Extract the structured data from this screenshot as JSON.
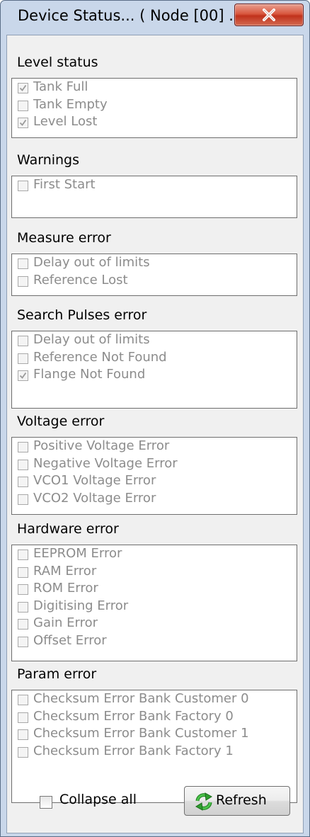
{
  "window": {
    "title": "Device Status... ( Node [00] ..."
  },
  "sections": [
    {
      "title": "Level status",
      "items": [
        {
          "label": "Tank Full",
          "checked": true
        },
        {
          "label": "Tank Empty",
          "checked": false
        },
        {
          "label": "Level Lost",
          "checked": true
        }
      ]
    },
    {
      "title": "Warnings",
      "items": [
        {
          "label": "First Start",
          "checked": false
        }
      ]
    },
    {
      "title": "Measure error",
      "items": [
        {
          "label": "Delay out of limits",
          "checked": false
        },
        {
          "label": "Reference Lost",
          "checked": false
        }
      ]
    },
    {
      "title": "Search Pulses error",
      "items": [
        {
          "label": "Delay out of limits",
          "checked": false
        },
        {
          "label": "Reference Not Found",
          "checked": false
        },
        {
          "label": "Flange Not Found",
          "checked": true
        }
      ]
    },
    {
      "title": "Voltage error",
      "items": [
        {
          "label": "Positive Voltage Error",
          "checked": false
        },
        {
          "label": "Negative Voltage Error",
          "checked": false
        },
        {
          "label": "VCO1 Voltage Error",
          "checked": false
        },
        {
          "label": "VCO2 Voltage Error",
          "checked": false
        }
      ]
    },
    {
      "title": "Hardware error",
      "items": [
        {
          "label": "EEPROM Error",
          "checked": false
        },
        {
          "label": "RAM Error",
          "checked": false
        },
        {
          "label": "ROM Error",
          "checked": false
        },
        {
          "label": "Digitising Error",
          "checked": false
        },
        {
          "label": "Gain Error",
          "checked": false
        },
        {
          "label": "Offset Error",
          "checked": false
        }
      ]
    },
    {
      "title": "Param error",
      "items": [
        {
          "label": "Checksum Error Bank Customer 0",
          "checked": false
        },
        {
          "label": "Checksum Error Bank Factory 0",
          "checked": false
        },
        {
          "label": "Checksum Error Bank Customer 1",
          "checked": false
        },
        {
          "label": "Checksum Error Bank Factory 1",
          "checked": false
        }
      ]
    }
  ],
  "footer": {
    "collapse_label": "Collapse all",
    "collapse_checked": false,
    "refresh_label": "Refresh"
  },
  "icons": {
    "close": "close-icon",
    "refresh": "refresh-icon",
    "check": "check-icon"
  },
  "colors": {
    "close_button": "#c7432b",
    "refresh_icon": "#2f9e2f",
    "disabled_text": "#8c8c8c"
  }
}
